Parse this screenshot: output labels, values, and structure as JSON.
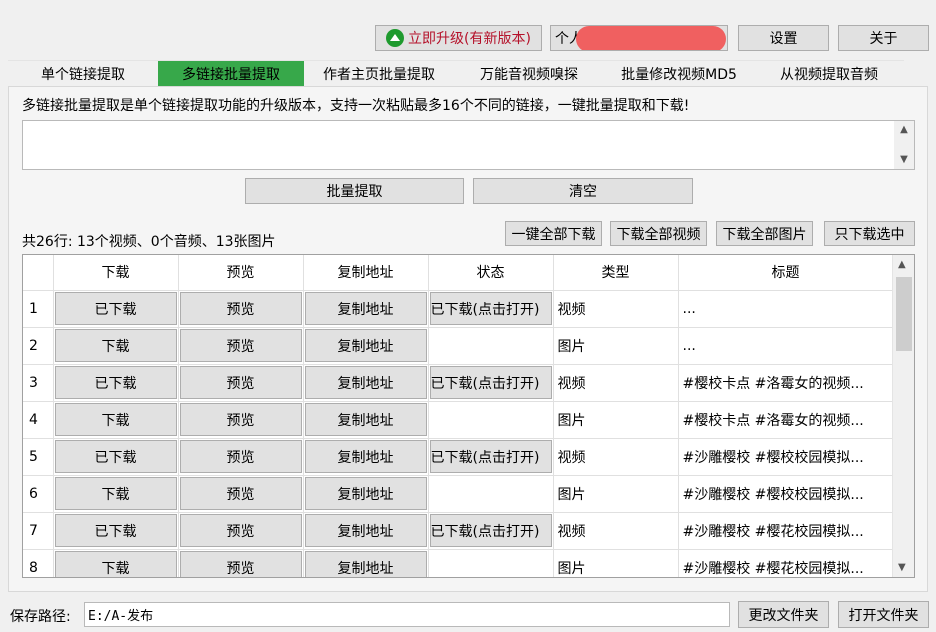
{
  "header": {
    "upgrade_label": "立即升级(有新版本)",
    "account_label": "个人",
    "settings_label": "设置",
    "about_label": "关于"
  },
  "tabs": [
    {
      "label": "单个链接提取"
    },
    {
      "label": "多链接批量提取"
    },
    {
      "label": "作者主页批量提取"
    },
    {
      "label": "万能音视频嗅探"
    },
    {
      "label": "批量修改视频MD5"
    },
    {
      "label": "从视频提取音频"
    }
  ],
  "active_tab_color": "#37a84a",
  "description": "多链接批量提取是单个链接提取功能的升级版本，支持一次粘贴最多16个不同的链接，一键批量提取和下载!",
  "link_input": {
    "value": ""
  },
  "actions": {
    "batch_extract_label": "批量提取",
    "clear_label": "清空"
  },
  "summary": "共26行: 13个视频、0个音频、13张图片",
  "download_actions": {
    "all_label": "一键全部下载",
    "all_video_label": "下载全部视频",
    "all_image_label": "下载全部图片",
    "selected_label": "只下载选中"
  },
  "table": {
    "columns": [
      "下载",
      "预览",
      "复制地址",
      "状态",
      "类型",
      "标题"
    ],
    "rows": [
      {
        "num": "1",
        "download": "已下载",
        "preview": "预览",
        "copy": "复制地址",
        "status": "已下载(点击打开)",
        "type": "视频",
        "title": "..."
      },
      {
        "num": "2",
        "download": "下载",
        "preview": "预览",
        "copy": "复制地址",
        "status": "",
        "type": "图片",
        "title": "..."
      },
      {
        "num": "3",
        "download": "已下载",
        "preview": "预览",
        "copy": "复制地址",
        "status": "已下载(点击打开)",
        "type": "视频",
        "title": "#樱校卡点 #洛霉女的视频..."
      },
      {
        "num": "4",
        "download": "下载",
        "preview": "预览",
        "copy": "复制地址",
        "status": "",
        "type": "图片",
        "title": "#樱校卡点 #洛霉女的视频..."
      },
      {
        "num": "5",
        "download": "已下载",
        "preview": "预览",
        "copy": "复制地址",
        "status": "已下载(点击打开)",
        "type": "视频",
        "title": "#沙雕樱校 #樱校校园模拟..."
      },
      {
        "num": "6",
        "download": "下载",
        "preview": "预览",
        "copy": "复制地址",
        "status": "",
        "type": "图片",
        "title": "#沙雕樱校 #樱校校园模拟..."
      },
      {
        "num": "7",
        "download": "已下载",
        "preview": "预览",
        "copy": "复制地址",
        "status": "已下载(点击打开)",
        "type": "视频",
        "title": "#沙雕樱校 #樱花校园模拟..."
      },
      {
        "num": "8",
        "download": "下载",
        "preview": "预览",
        "copy": "复制地址",
        "status": "",
        "type": "图片",
        "title": "#沙雕樱校 #樱花校园模拟..."
      }
    ]
  },
  "footer": {
    "save_path_label": "保存路径:",
    "save_path_value": "E:/A-发布",
    "change_folder_label": "更改文件夹",
    "open_folder_label": "打开文件夹"
  }
}
